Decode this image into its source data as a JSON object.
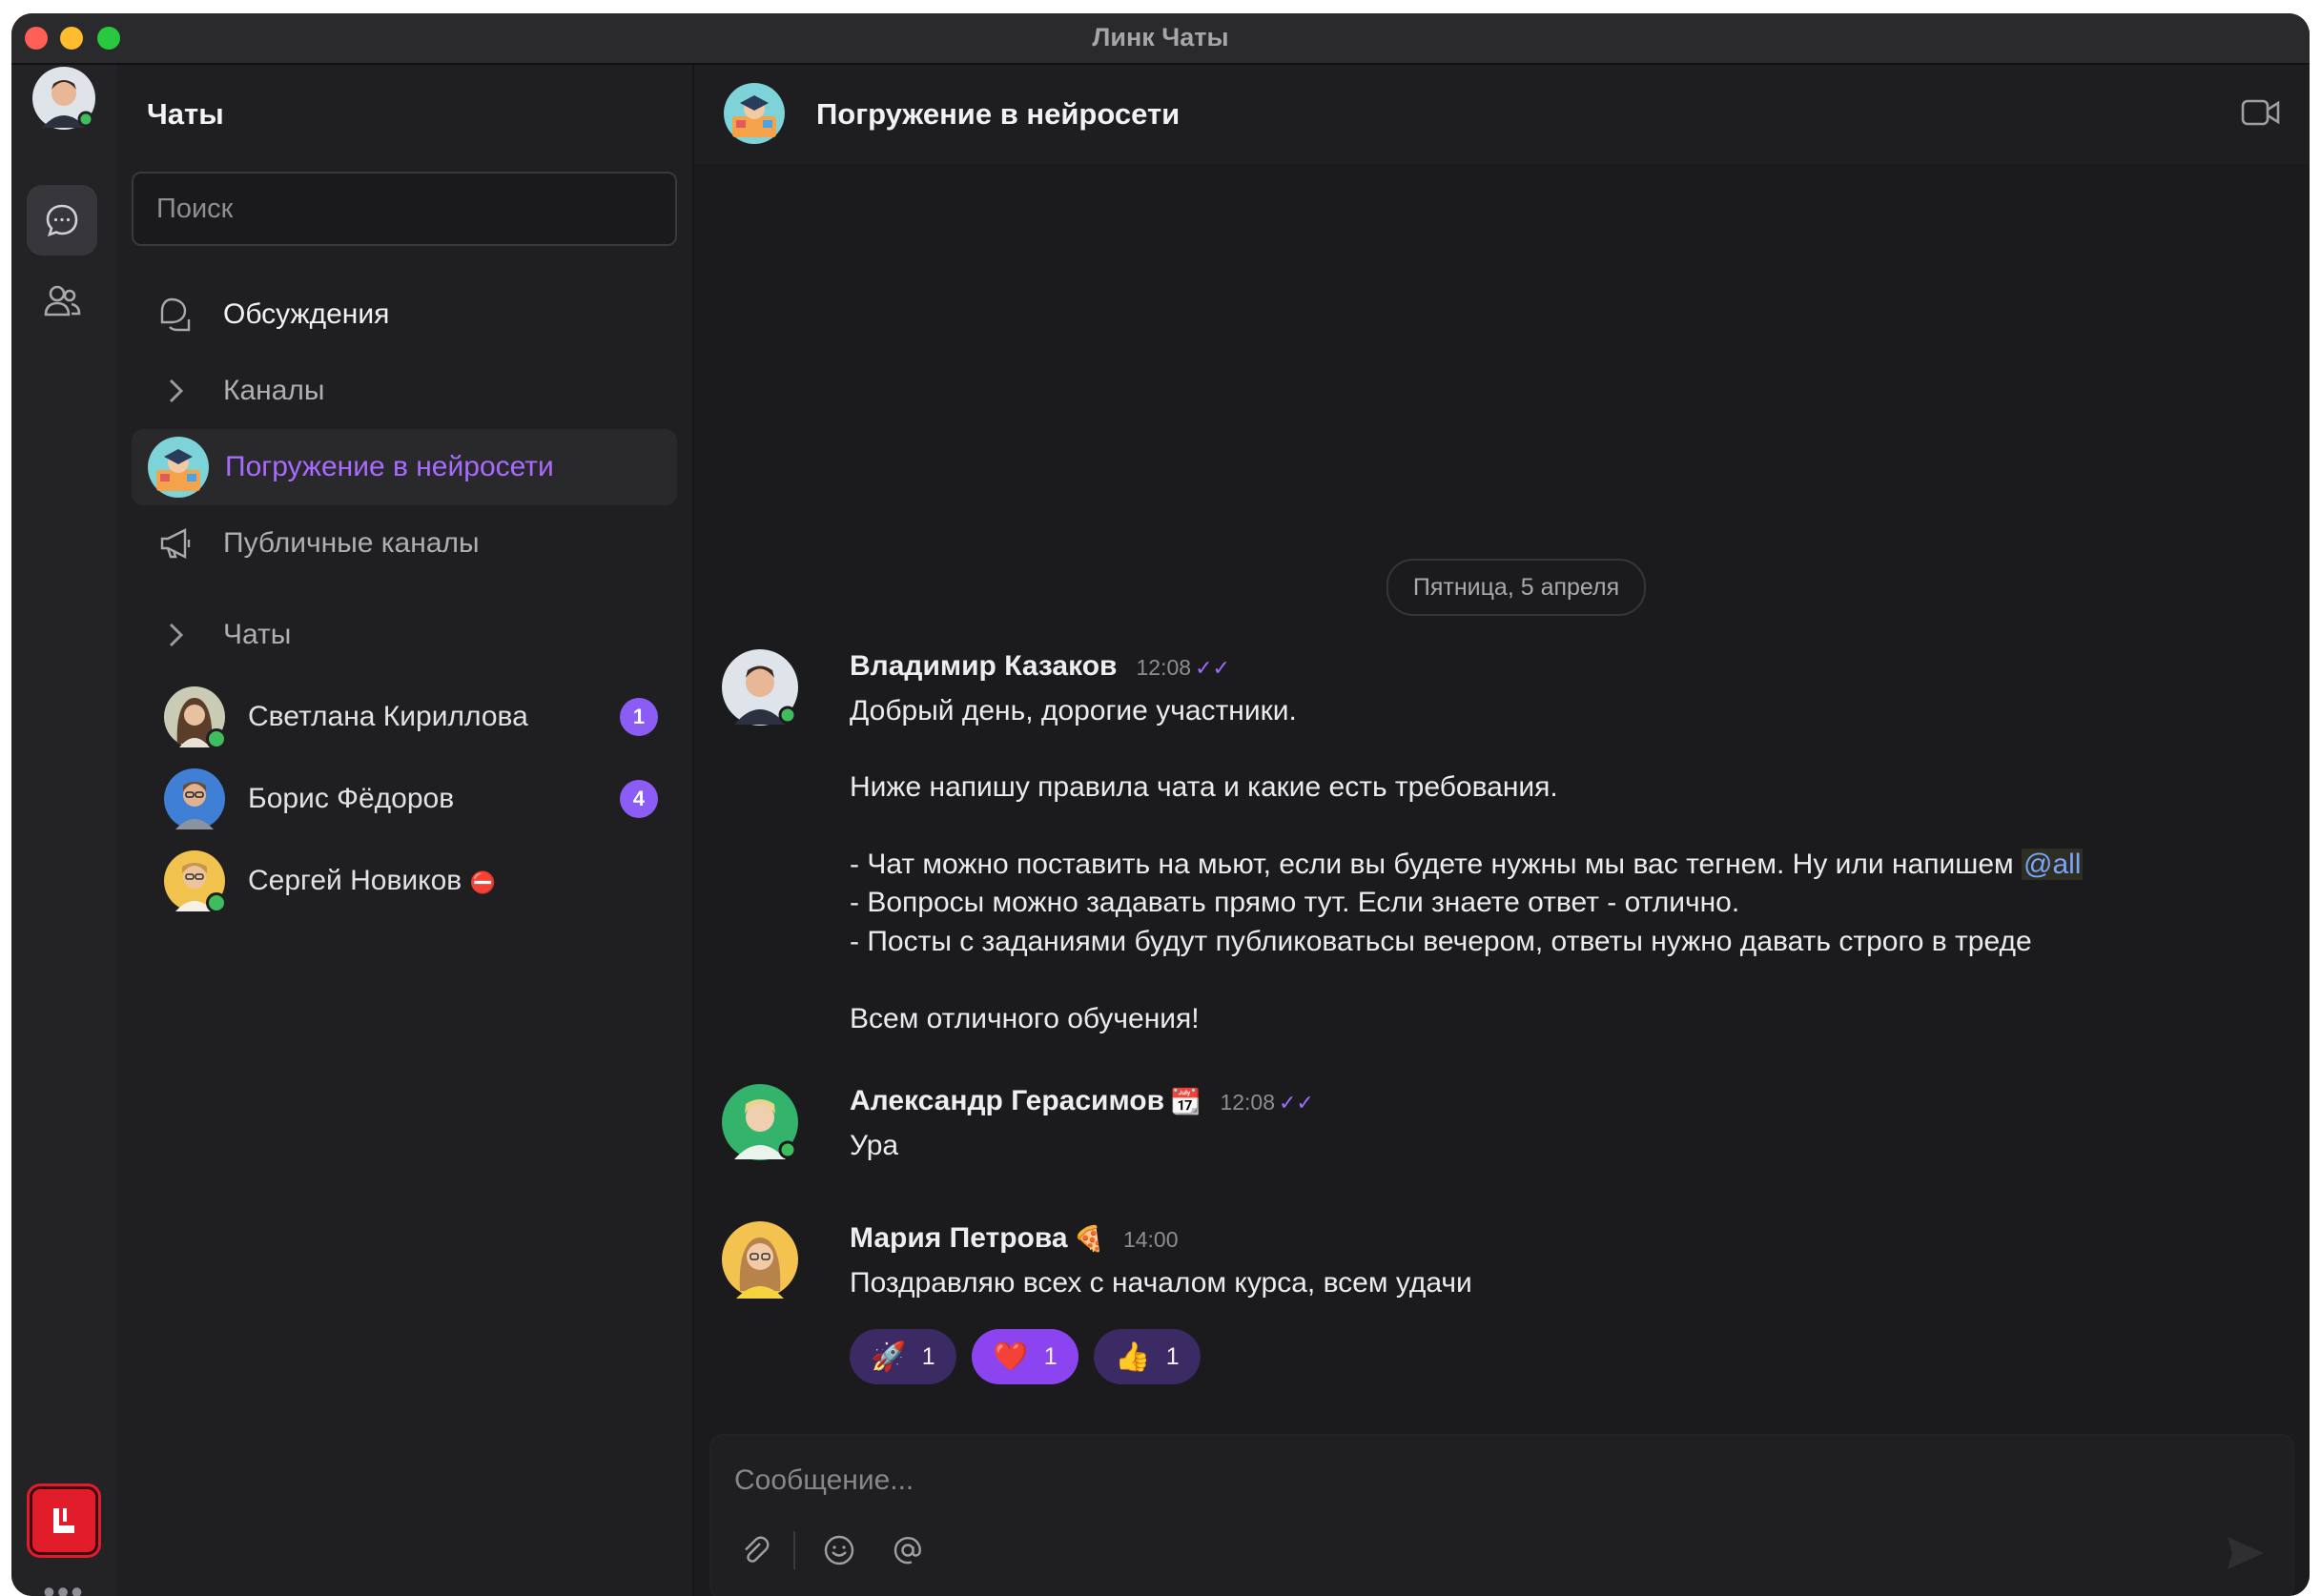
{
  "window": {
    "title": "Линк Чаты"
  },
  "sidebar": {
    "title": "Чаты",
    "search": {
      "placeholder": "Поиск",
      "value": ""
    },
    "nav": [
      {
        "label": "Обсуждения",
        "icon": "discussions-icon"
      },
      {
        "label": "Каналы",
        "icon": "chevron-right-icon"
      },
      {
        "label": "Погружение в нейросети",
        "icon": "channel-avatar",
        "active": true
      },
      {
        "label": "Публичные каналы",
        "icon": "megaphone-icon"
      },
      {
        "label": "Чаты",
        "icon": "chevron-right-icon"
      }
    ],
    "chats": [
      {
        "name": "Светлана Кириллова",
        "unread": "1",
        "online": true
      },
      {
        "name": "Борис Фёдоров",
        "unread": "4",
        "online": false
      },
      {
        "name": "Сергей Новиков",
        "status_emoji": "⛔",
        "online": true
      }
    ]
  },
  "header": {
    "title": "Погружение в нейросети"
  },
  "date_separator": "Пятница, 5 апреля",
  "messages": [
    {
      "author": "Владимир Казаков",
      "time": "12:08",
      "read": true,
      "lines": [
        "Добрый день, дорогие участники.",
        "Ниже напишу правила чата и какие есть требования.",
        "- Чат можно поставить на мьют, если вы будете нужны мы вас тегнем. Ну или напишем ",
        "- Вопросы можно задавать прямо тут. Если знаете ответ - отлично.",
        "- Посты с заданиями будут публиковатьсы вечером, ответы нужно давать строго в треде",
        "Всем отличного обучения!"
      ],
      "mention": "@all"
    },
    {
      "author": "Александр Герасимов",
      "status_emoji": "📆",
      "time": "12:08",
      "read": true,
      "text": "Ура"
    },
    {
      "author": "Мария Петрова",
      "status_emoji": "🍕",
      "time": "14:00",
      "text": "Поздравляю всех с началом курса, всем удачи",
      "reactions": [
        {
          "emoji": "🚀",
          "count": "1",
          "active": false
        },
        {
          "emoji": "❤️",
          "count": "1",
          "active": true
        },
        {
          "emoji": "👍",
          "count": "1",
          "active": false
        }
      ]
    }
  ],
  "composer": {
    "placeholder": "Сообщение..."
  },
  "colors": {
    "accent": "#8b5cf6",
    "active_text": "#a96bff",
    "online": "#3fbd5c",
    "logo": "#e11d2c"
  }
}
